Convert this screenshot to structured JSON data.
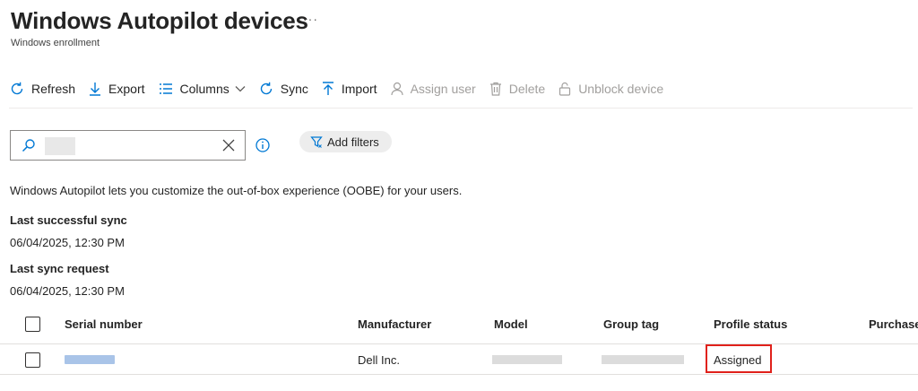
{
  "page": {
    "title": "Windows Autopilot devices",
    "more": "···",
    "subtitle": "Windows enrollment"
  },
  "toolbar": {
    "refresh": "Refresh",
    "export": "Export",
    "columns": "Columns",
    "sync": "Sync",
    "import": "Import",
    "assign_user": "Assign user",
    "delete": "Delete",
    "unblock_device": "Unblock device"
  },
  "search": {
    "value": "",
    "placeholder": ""
  },
  "filters": {
    "add_filters": "Add filters"
  },
  "info": {
    "description": "Windows Autopilot lets you customize the out-of-box experience (OOBE) for your users.",
    "last_successful_sync_label": "Last successful sync",
    "last_successful_sync_value": "06/04/2025, 12:30 PM",
    "last_sync_request_label": "Last sync request",
    "last_sync_request_value": "06/04/2025, 12:30 PM"
  },
  "table": {
    "headers": {
      "serial_number": "Serial number",
      "manufacturer": "Manufacturer",
      "model": "Model",
      "group_tag": "Group tag",
      "profile_status": "Profile status",
      "purchase": "Purchase"
    },
    "rows": [
      {
        "manufacturer": "Dell Inc.",
        "profile_status": "Assigned"
      }
    ]
  },
  "icons": {
    "refresh": "refresh-icon",
    "export": "download-icon",
    "columns": "columns-icon",
    "sync": "sync-icon",
    "import": "upload-icon",
    "assign_user": "person-icon",
    "delete": "trash-icon",
    "unblock_device": "lock-icon"
  },
  "colors": {
    "accent": "#0078d4",
    "highlight": "#e0211b",
    "disabled": "#a19f9d"
  }
}
